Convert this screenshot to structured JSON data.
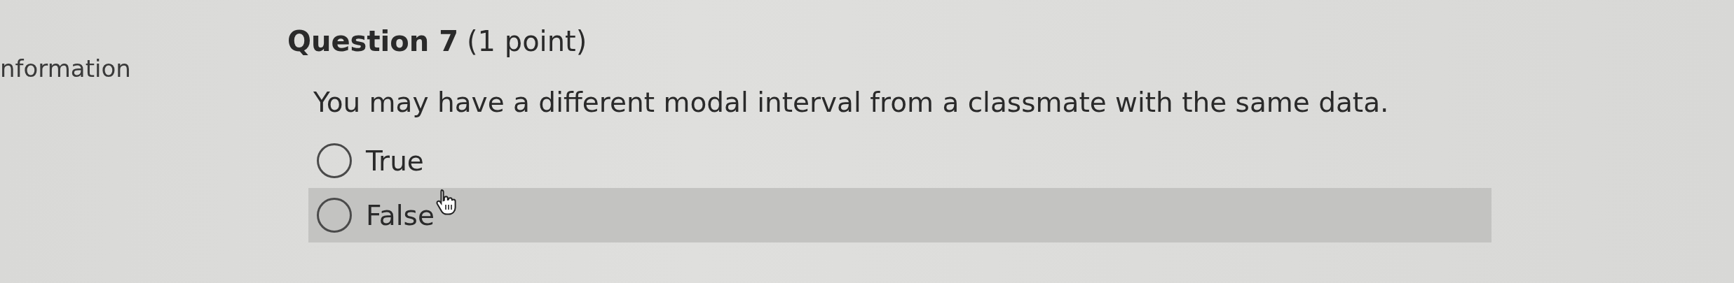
{
  "sidebar": {
    "label": "nformation"
  },
  "question": {
    "title": "Question 7",
    "points": "(1 point)",
    "prompt": "You may have a different modal interval from a classmate with the same data.",
    "options": [
      {
        "label": "True",
        "selected": false,
        "hovered": false
      },
      {
        "label": "False",
        "selected": false,
        "hovered": true
      }
    ]
  }
}
